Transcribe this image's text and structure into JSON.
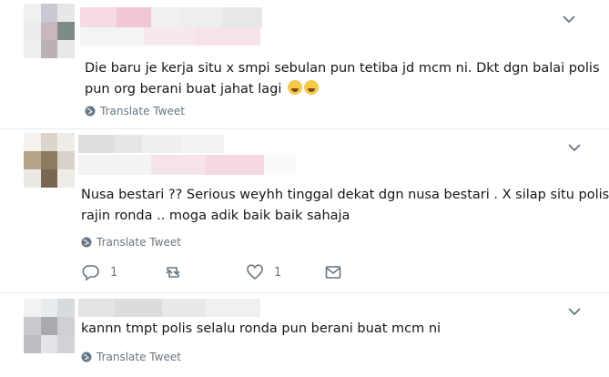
{
  "tweets": [
    {
      "text_lines": [
        "Die baru je kerja situ x smpi sebulan pun tetiba jd mcm ni. Dkt dgn balai polis",
        "pun org berani buat jahat lagi"
      ],
      "emojis": [
        "loudly-crying-face",
        "loudly-crying-face"
      ],
      "translate_label": "Translate Tweet"
    },
    {
      "text_lines": [
        "Nusa bestari  ?? Serious weyhh tinggal dekat dgn nusa bestari . X silap situ polis",
        "rajin ronda .. moga adik baik baik sahaja"
      ],
      "translate_label": "Translate Tweet",
      "actions": {
        "reply_count": "1",
        "retweet_count": "",
        "like_count": "1"
      }
    },
    {
      "text_lines": [
        "kannn tmpt polis selalu ronda pun berani buat mcm ni"
      ],
      "translate_label": "Translate Tweet"
    }
  ],
  "colors": {
    "text": "#14171a",
    "secondary": "#657786",
    "divider": "#e6ecf0"
  }
}
